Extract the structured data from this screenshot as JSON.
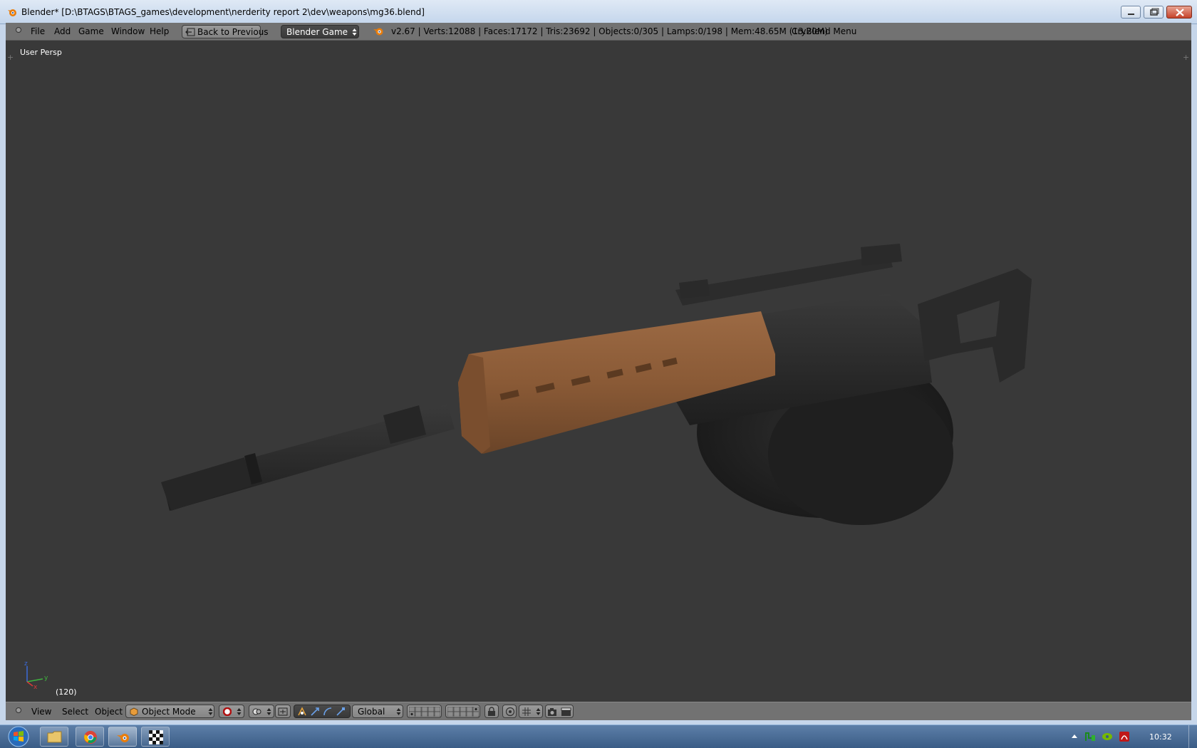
{
  "window": {
    "title": "Blender* [D:\\BTAGS\\BTAGS_games\\development\\nerderity report 2\\dev\\weapons\\mg36.blend]",
    "controls": [
      "minimize-icon",
      "maximize-icon",
      "close-icon"
    ]
  },
  "info_header": {
    "menus": [
      "File",
      "Add",
      "Game",
      "Window",
      "Help"
    ],
    "back_label": "Back to Previous",
    "engine": "Blender Game",
    "stats": "v2.67 | Verts:12088 | Faces:17172 | Tris:23692 | Objects:0/305 | Lamps:0/198 | Mem:48.65M (13.20M)",
    "addon_menu": "CryBlend Menu"
  },
  "viewport": {
    "label": "User Persp",
    "frame": "(120)",
    "axis_labels": {
      "z": "z",
      "y": "y",
      "x": "x"
    },
    "background": "#393939",
    "model_colors": {
      "metal": "#2a2a2a",
      "handguard": "#8a5a36"
    }
  },
  "view_header": {
    "menus": [
      "View",
      "Select",
      "Object"
    ],
    "mode": "Object Mode",
    "orientation": "Global"
  },
  "taskbar": {
    "clock": "10:32",
    "apps": [
      "explorer-icon",
      "chrome-icon",
      "blender-icon",
      "checker-app-icon"
    ]
  }
}
